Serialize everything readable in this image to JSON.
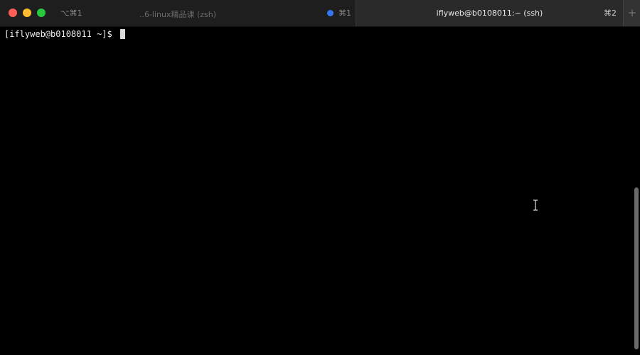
{
  "tabs": [
    {
      "alt_shortcut": "⌥⌘1",
      "title": "..6-linux精品课 (zsh)",
      "cmd_shortcut": "⌘1",
      "indicator_color": "#3478f6",
      "active": false
    },
    {
      "title": "iflyweb@b0108011:~ (ssh)",
      "cmd_shortcut": "⌘2",
      "active": true
    }
  ],
  "new_tab_label": "+",
  "terminal": {
    "prompt": "[iflyweb@b0108011 ~]$ "
  },
  "colors": {
    "close": "#ff5f57",
    "minimize": "#febc2e",
    "zoom": "#28c840"
  }
}
